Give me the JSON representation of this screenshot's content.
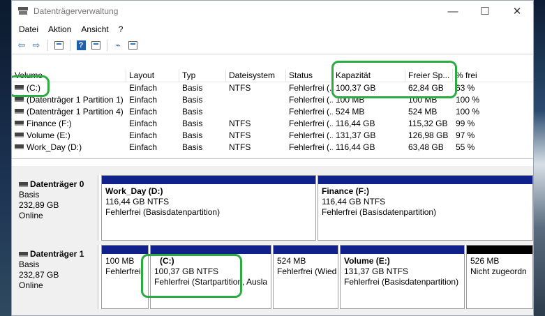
{
  "window": {
    "title": "Datenträgerverwaltung"
  },
  "menu": [
    "Datei",
    "Aktion",
    "Ansicht",
    "?"
  ],
  "table": {
    "headers": [
      "Volume",
      "Layout",
      "Typ",
      "Dateisystem",
      "Status",
      "Kapazität",
      "Freier Sp...",
      "% frei"
    ],
    "rows": [
      [
        "(C:)",
        "Einfach",
        "Basis",
        "NTFS",
        "Fehlerfrei (...",
        "100,37 GB",
        "62,84 GB",
        "63 %"
      ],
      [
        "(Datenträger 1 Partition 1)",
        "Einfach",
        "Basis",
        "",
        "Fehlerfrei (...",
        "100 MB",
        "100 MB",
        "100 %"
      ],
      [
        "(Datenträger 1 Partition 4)",
        "Einfach",
        "Basis",
        "",
        "Fehlerfrei (...",
        "524 MB",
        "524 MB",
        "100 %"
      ],
      [
        "Finance (F:)",
        "Einfach",
        "Basis",
        "NTFS",
        "Fehlerfrei (...",
        "116,44 GB",
        "115,32 GB",
        "99 %"
      ],
      [
        "Volume (E:)",
        "Einfach",
        "Basis",
        "NTFS",
        "Fehlerfrei (...",
        "131,37 GB",
        "126,98 GB",
        "97 %"
      ],
      [
        "Work_Day (D:)",
        "Einfach",
        "Basis",
        "NTFS",
        "Fehlerfrei (...",
        "116,44 GB",
        "63,48 GB",
        "55 %"
      ]
    ]
  },
  "disks": [
    {
      "name": "Datenträger 0",
      "type": "Basis",
      "size": "232,89 GB",
      "state": "Online",
      "partitions": [
        {
          "title": "Work_Day  (D:)",
          "size": "116,44 GB NTFS",
          "status": "Fehlerfrei (Basisdatenpartition)"
        },
        {
          "title": "Finance  (F:)",
          "size": "116,44 GB NTFS",
          "status": "Fehlerfrei (Basisdatenpartition)"
        }
      ]
    },
    {
      "name": "Datenträger 1",
      "type": "Basis",
      "size": "232,87 GB",
      "state": "Online",
      "partitions": [
        {
          "title": "",
          "size": "100 MB",
          "status": "Fehlerfrei"
        },
        {
          "title": "(C:)",
          "size": "100,37 GB NTFS",
          "status": "Fehlerfrei (Startpartition, Ausla"
        },
        {
          "title": "",
          "size": "524 MB",
          "status": "Fehlerfrei (Wied"
        },
        {
          "title": "Volume  (E:)",
          "size": "131,37 GB NTFS",
          "status": "Fehlerfrei (Basisdatenpartition)"
        },
        {
          "title": "",
          "size": "526 MB",
          "status": "Nicht zugeordn"
        }
      ]
    }
  ],
  "colors": {
    "partition_bar": "#11218c",
    "unallocated_bar": "#000000",
    "highlight": "#2bab40"
  }
}
